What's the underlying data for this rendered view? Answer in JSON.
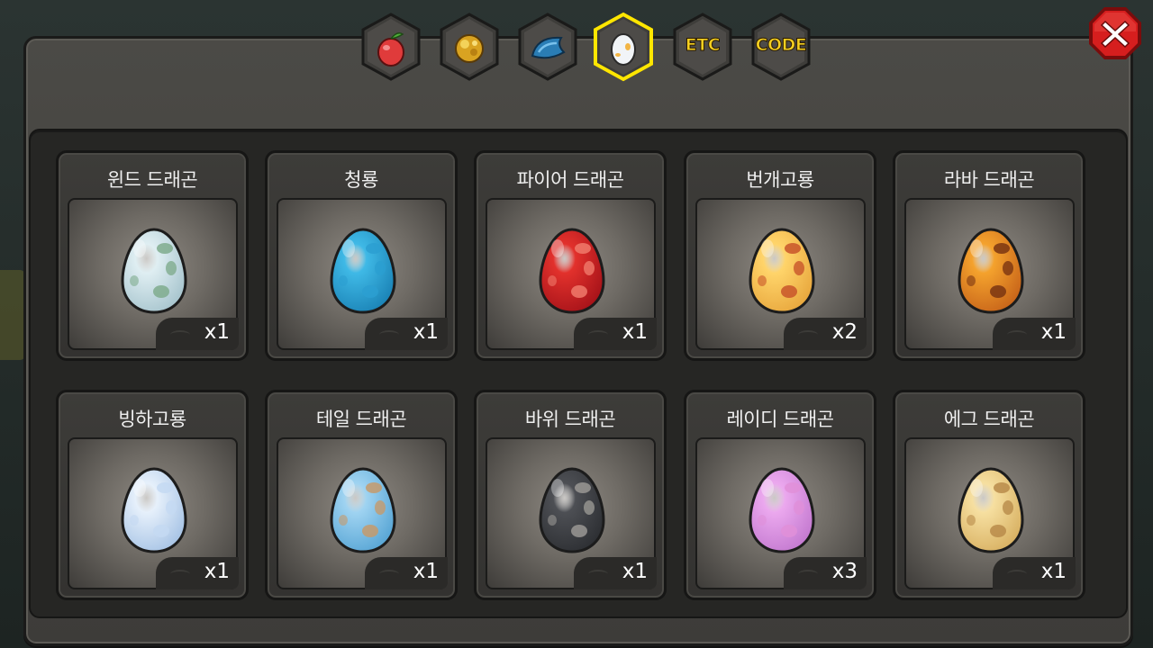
{
  "tabs": [
    {
      "name": "fruit-tab",
      "icon": "red-fruit-icon",
      "active": false
    },
    {
      "name": "gold-tab",
      "icon": "gold-ore-icon",
      "active": false
    },
    {
      "name": "scale-tab",
      "icon": "blue-scale-icon",
      "active": false
    },
    {
      "name": "egg-tab",
      "icon": "egg-icon",
      "active": true
    },
    {
      "name": "etc-tab",
      "label": "ETC",
      "active": false
    },
    {
      "name": "code-tab",
      "label": "CODE",
      "active": false
    }
  ],
  "close_icon": "close-x-icon",
  "colors": {
    "active_tab_border": "#ffe600",
    "tab_label": "#f5d021",
    "close_red": "#d61e1e"
  },
  "items": [
    {
      "title": "윈드 드래곤",
      "qty": "x1",
      "egg": {
        "base": "#dfeef2",
        "shade": "#a9c6cf",
        "spot": "#7fab8d"
      }
    },
    {
      "title": "청룡",
      "qty": "x1",
      "egg": {
        "base": "#3fb9e6",
        "shade": "#1c85b8",
        "spot": "#2b9fd1"
      }
    },
    {
      "title": "파이어 드래곤",
      "qty": "x1",
      "egg": {
        "base": "#e2312c",
        "shade": "#a8141a",
        "spot": "#f07a6b"
      }
    },
    {
      "title": "번개고룡",
      "qty": "x2",
      "egg": {
        "base": "#ffd46a",
        "shade": "#e9a93f",
        "spot": "#c8552a"
      }
    },
    {
      "title": "라바 드래곤",
      "qty": "x1",
      "egg": {
        "base": "#f4a22d",
        "shade": "#c9661a",
        "spot": "#7a3512"
      }
    },
    {
      "title": "빙하고룡",
      "qty": "x1",
      "egg": {
        "base": "#e6f0fb",
        "shade": "#a9c5e6",
        "spot": "#c4d9f2"
      }
    },
    {
      "title": "테일 드래곤",
      "qty": "x1",
      "egg": {
        "base": "#9fd3f1",
        "shade": "#5aa7d6",
        "spot": "#c69a6b"
      }
    },
    {
      "title": "바위 드래곤",
      "qty": "x1",
      "egg": {
        "base": "#4d4f54",
        "shade": "#2e3034",
        "spot": "#9a9894"
      }
    },
    {
      "title": "레이디 드래곤",
      "qty": "x3",
      "egg": {
        "base": "#eba8ee",
        "shade": "#c57bd1",
        "spot": "#e08fd8"
      }
    },
    {
      "title": "에그 드래곤",
      "qty": "x1",
      "egg": {
        "base": "#f6dfa0",
        "shade": "#d9b264",
        "spot": "#b88b4a"
      }
    }
  ]
}
